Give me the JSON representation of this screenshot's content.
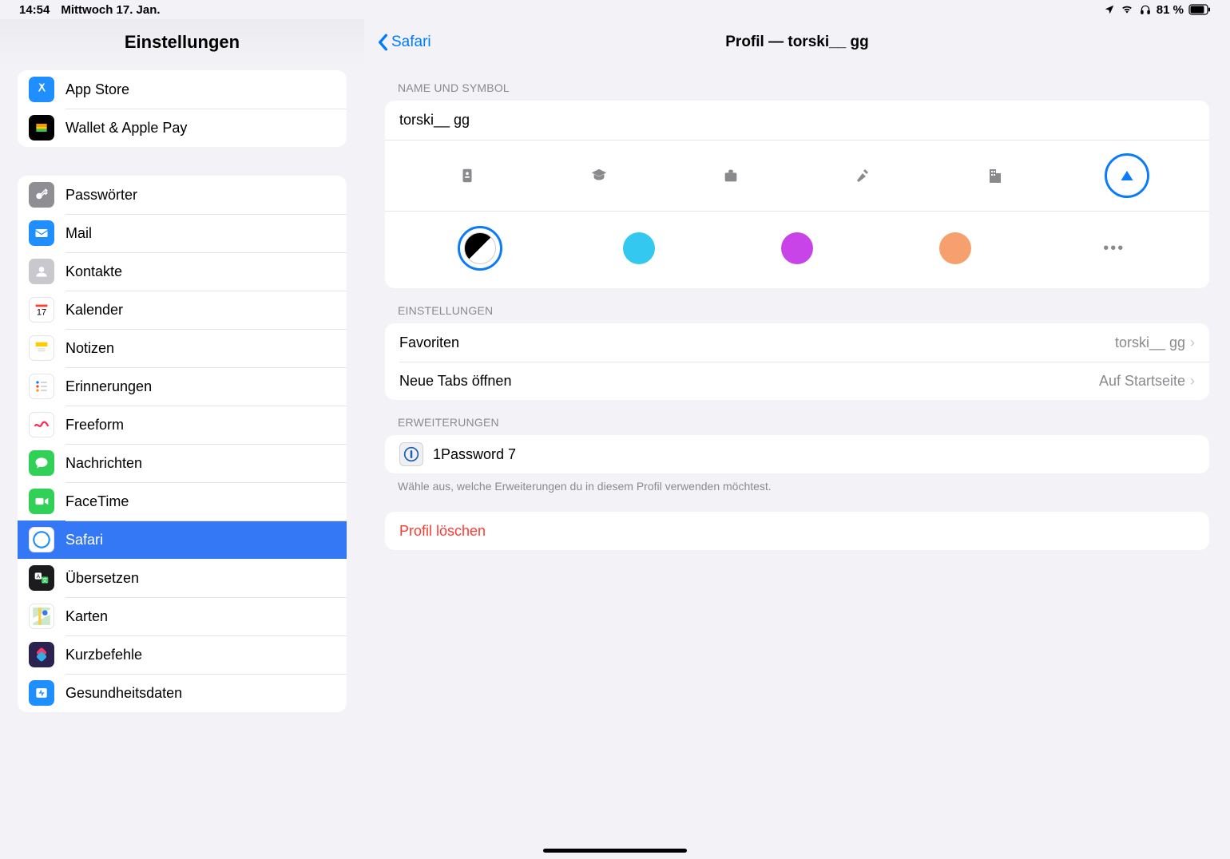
{
  "status": {
    "time": "14:54",
    "date": "Mittwoch 17. Jan.",
    "battery": "81 %"
  },
  "sidebar": {
    "title": "Einstellungen",
    "group1": [
      {
        "label": "App Store"
      },
      {
        "label": "Wallet & Apple Pay"
      }
    ],
    "group2": [
      {
        "label": "Passwörter"
      },
      {
        "label": "Mail"
      },
      {
        "label": "Kontakte"
      },
      {
        "label": "Kalender"
      },
      {
        "label": "Notizen"
      },
      {
        "label": "Erinnerungen"
      },
      {
        "label": "Freeform"
      },
      {
        "label": "Nachrichten"
      },
      {
        "label": "FaceTime"
      },
      {
        "label": "Safari"
      },
      {
        "label": "Übersetzen"
      },
      {
        "label": "Karten"
      },
      {
        "label": "Kurzbefehle"
      },
      {
        "label": "Gesundheitsdaten"
      }
    ]
  },
  "detail": {
    "back": "Safari",
    "title": "Profil — torski__ gg",
    "name_section": "NAME UND SYMBOL",
    "profile_name": "torski__ gg",
    "symbols": [
      "badge",
      "graduation",
      "briefcase",
      "hammer",
      "building",
      "triangle"
    ],
    "colors": [
      "#000000",
      "#32c8ef",
      "#c844e8",
      "#f5a06e"
    ],
    "settings_section": "EINSTELLUNGEN",
    "favorites_label": "Favoriten",
    "favorites_value": "torski__ gg",
    "newtabs_label": "Neue Tabs öffnen",
    "newtabs_value": "Auf Startseite",
    "extensions_section": "ERWEITERUNGEN",
    "extension1": "1Password 7",
    "extensions_footer": "Wähle aus, welche Erweiterungen du in diesem Profil verwenden möchtest.",
    "delete_label": "Profil löschen"
  }
}
